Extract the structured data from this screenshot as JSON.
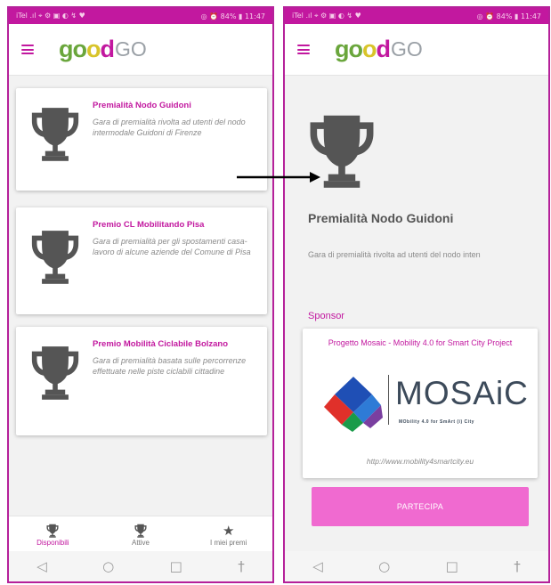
{
  "status_bar": {
    "left": "iTel .ıl ⌖ ⚙ ▣ ◐ ↯ ♥",
    "right": "◎ ⏰ 84% ▮ 11:47"
  },
  "logo": {
    "g": "g",
    "o1": "o",
    "o2": "o",
    "d": "d",
    "go": "GO"
  },
  "list_screen": {
    "cards": [
      {
        "title": "Premialità Nodo Guidoni",
        "description": "Gara di premialità rivolta ad utenti del nodo intermodale Guidoni di Firenze"
      },
      {
        "title": "Premio CL Mobilitando Pisa",
        "description": "Gara di premialità per gli spostamenti casa-lavoro di alcune aziende del Comune di Pisa"
      },
      {
        "title": "Premio Mobilità Ciclabile Bolzano",
        "description": "Gara di premialità basata sulle percorrenze effettuate nelle piste ciclabili cittadine"
      }
    ],
    "bottom_nav": [
      {
        "label": "Disponibili",
        "icon": "trophy-icon",
        "active": true
      },
      {
        "label": "Attive",
        "icon": "trophy-icon",
        "active": false
      },
      {
        "label": "I miei premi",
        "icon": "star-icon",
        "active": false
      }
    ]
  },
  "detail_screen": {
    "title": "Premialità Nodo Guidoni",
    "description": "Gara di premialità rivolta ad utenti del nodo inten",
    "sponsor_label": "Sponsor",
    "sponsor": {
      "title": "Progetto Mosaic - Mobility 4.0 for Smart City Project",
      "logo_name": "MOSAiC",
      "logo_tagline": "MObility 4.0 for SmArt (i) City",
      "url": "http://www.mobility4smartcity.eu"
    },
    "button_label": "PARTECIPA"
  },
  "system_nav": {
    "back": "◁",
    "home": "○",
    "recents": "□",
    "accessibility": "†"
  },
  "colors": {
    "brand_magenta": "#c2189f",
    "button_pink": "#f06ad0",
    "icon_grey": "#555555"
  }
}
